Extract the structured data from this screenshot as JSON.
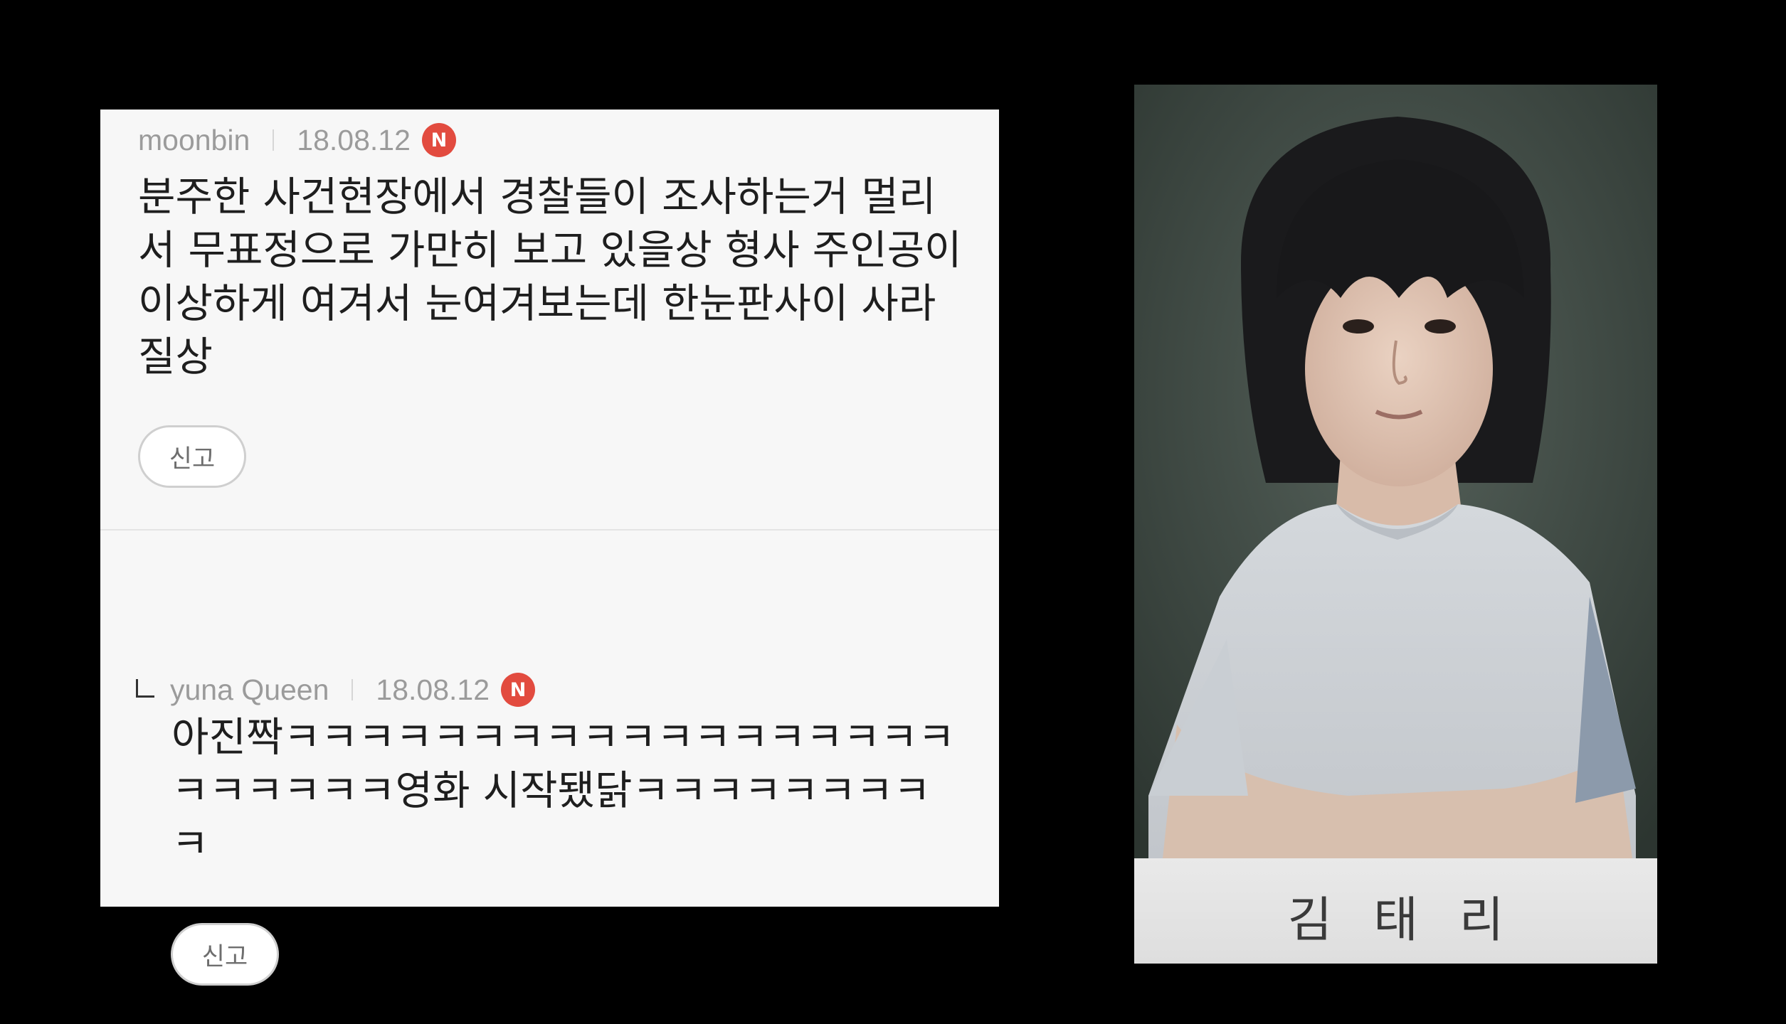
{
  "comments": [
    {
      "author": "moonbin",
      "date": "18.08.12",
      "badge": "N",
      "text": "분주한 사건현장에서 경찰들이 조사하는거 멀리\n서 무표정으로 가만히 보고 있을상 형사 주인공이\n이상하게 여겨서 눈여겨보는데 한눈판사이 사라\n질상",
      "report_label": "신고"
    },
    {
      "author": "yuna Queen",
      "date": "18.08.12",
      "badge": "N",
      "text": "아진짝ㅋㅋㅋㅋㅋㅋㅋㅋㅋㅋㅋㅋㅋㅋㅋㅋㅋㅋ\nㅋㅋㅋㅋㅋㅋ영화 시작됐닭ㅋㅋㅋㅋㅋㅋㅋㅋ\nㅋ",
      "report_label": "신고"
    }
  ],
  "photo": {
    "name_label": "김태리"
  },
  "colors": {
    "background": "#000000",
    "panel": "#f7f7f7",
    "badge": "#e24b3f",
    "meta_text": "#9b9b9b"
  },
  "icons": [
    "reply-arrow-icon",
    "new-badge-icon"
  ]
}
